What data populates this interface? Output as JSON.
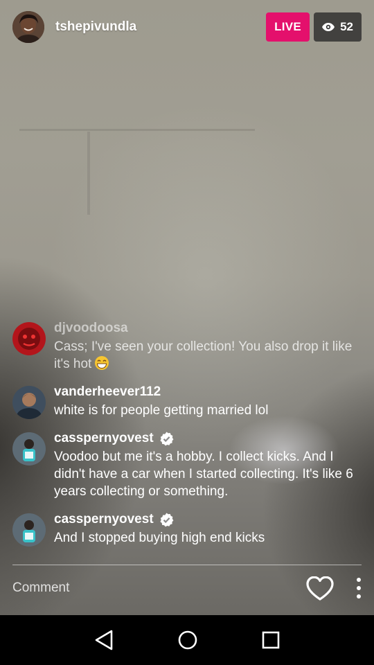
{
  "header": {
    "host_username": "tshepivundla",
    "live_label": "LIVE",
    "viewer_count": "52"
  },
  "comments": [
    {
      "username": "djvoodoosa",
      "text": "Cass; I've seen your collection! You also drop it like it's hot",
      "emoji": "grinning-face-emoji",
      "verified": false
    },
    {
      "username": "vanderheever112",
      "text": "white is for people getting married lol",
      "verified": false
    },
    {
      "username": "casspernyovest",
      "text": "Voodoo but me it's a hobby. I collect kicks. And I didn't have a car when I started collecting. It's like 6 years collecting or something.",
      "verified": true
    },
    {
      "username": "casspernyovest",
      "text": "And I stopped buying high end kicks",
      "verified": true
    }
  ],
  "comment_bar": {
    "placeholder": "Comment"
  },
  "colors": {
    "live": "#e4106c",
    "verified": "#ffffff"
  },
  "icons": {
    "viewer": "eye-icon",
    "like": "heart-icon",
    "more": "more-options-icon",
    "back": "nav-back-icon",
    "home": "nav-home-icon",
    "recents": "nav-recents-icon"
  }
}
